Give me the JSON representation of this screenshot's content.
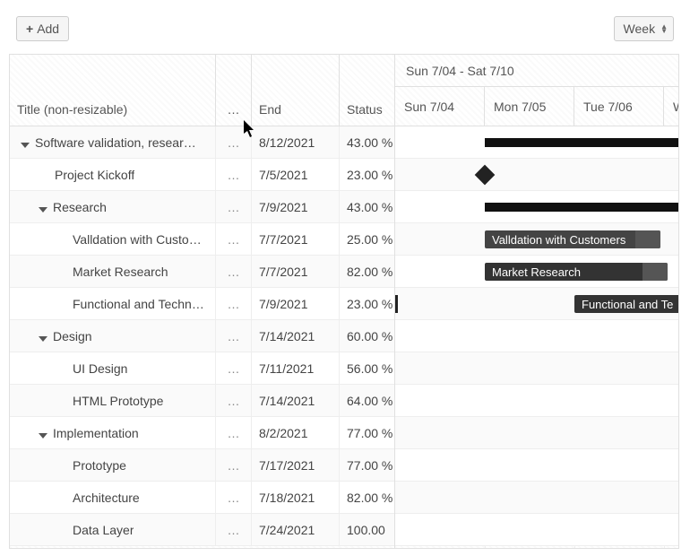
{
  "toolbar": {
    "add_label": "Add",
    "view_select": "Week"
  },
  "grid": {
    "headers": {
      "title": "Title (non-resizable)",
      "ellipsis": "…",
      "end": "End",
      "status": "Status"
    },
    "rows": [
      {
        "title": "Software validation, resear…",
        "end": "8/12/2021",
        "status": "43.00 %",
        "indent": 0,
        "expandable": true
      },
      {
        "title": "Project Kickoff",
        "end": "7/5/2021",
        "status": "23.00 %",
        "indent": 1,
        "expandable": false
      },
      {
        "title": "Research",
        "end": "7/9/2021",
        "status": "43.00 %",
        "indent": 1,
        "expandable": true
      },
      {
        "title": "Valldation with Custo…",
        "end": "7/7/2021",
        "status": "25.00 %",
        "indent": 2,
        "expandable": false
      },
      {
        "title": "Market Research",
        "end": "7/7/2021",
        "status": "82.00 %",
        "indent": 2,
        "expandable": false
      },
      {
        "title": "Functional and Techn…",
        "end": "7/9/2021",
        "status": "23.00 %",
        "indent": 2,
        "expandable": false
      },
      {
        "title": "Design",
        "end": "7/14/2021",
        "status": "60.00 %",
        "indent": 1,
        "expandable": true
      },
      {
        "title": "UI Design",
        "end": "7/11/2021",
        "status": "56.00 %",
        "indent": 2,
        "expandable": false
      },
      {
        "title": "HTML Prototype",
        "end": "7/14/2021",
        "status": "64.00 %",
        "indent": 2,
        "expandable": false
      },
      {
        "title": "Implementation",
        "end": "8/2/2021",
        "status": "77.00 %",
        "indent": 1,
        "expandable": true
      },
      {
        "title": "Prototype",
        "end": "7/17/2021",
        "status": "77.00 %",
        "indent": 2,
        "expandable": false
      },
      {
        "title": "Architecture",
        "end": "7/18/2021",
        "status": "82.00 %",
        "indent": 2,
        "expandable": false
      },
      {
        "title": "Data Layer",
        "end": "7/24/2021",
        "status": "100.00",
        "indent": 2,
        "expandable": false
      }
    ]
  },
  "chart": {
    "range_label": "Sun 7/04 - Sat 7/10",
    "days": [
      "Sun 7/04",
      "Mon 7/05",
      "Tue 7/06",
      "W"
    ],
    "bars": {
      "validation": "Valldation with Customers",
      "market": "Market Research",
      "functional": "Functional and Te"
    }
  }
}
